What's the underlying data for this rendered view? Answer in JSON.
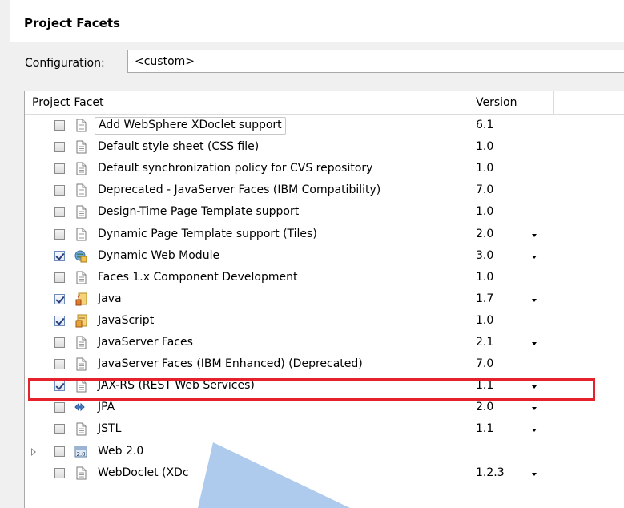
{
  "header": {
    "title": "Project Facets"
  },
  "configuration": {
    "label": "Configuration:",
    "value": "<custom>"
  },
  "table": {
    "columns": [
      "Project Facet",
      "Version"
    ],
    "rows": [
      {
        "label": "Add WebSphere XDoclet support",
        "version": "6.1",
        "checked": false,
        "icon": "document-icon",
        "dropdown": false
      },
      {
        "label": "Default style sheet (CSS file)",
        "version": "1.0",
        "checked": false,
        "icon": "document-icon",
        "dropdown": false
      },
      {
        "label": "Default synchronization policy for CVS repository",
        "version": "1.0",
        "checked": false,
        "icon": "document-icon",
        "dropdown": false
      },
      {
        "label": "Deprecated - JavaServer Faces (IBM Compatibility)",
        "version": "7.0",
        "checked": false,
        "icon": "document-icon",
        "dropdown": false
      },
      {
        "label": "Design-Time Page Template support",
        "version": "1.0",
        "checked": false,
        "icon": "document-icon",
        "dropdown": false
      },
      {
        "label": "Dynamic Page Template support (Tiles)",
        "version": "2.0",
        "checked": false,
        "icon": "document-icon",
        "dropdown": true
      },
      {
        "label": "Dynamic Web Module",
        "version": "3.0",
        "checked": true,
        "icon": "web-module-icon",
        "dropdown": true
      },
      {
        "label": "Faces 1.x Component Development",
        "version": "1.0",
        "checked": false,
        "icon": "document-icon",
        "dropdown": false
      },
      {
        "label": "Java",
        "version": "1.7",
        "checked": true,
        "icon": "java-icon",
        "dropdown": true
      },
      {
        "label": "JavaScript",
        "version": "1.0",
        "checked": true,
        "icon": "javascript-icon",
        "dropdown": false
      },
      {
        "label": "JavaServer Faces",
        "version": "2.1",
        "checked": false,
        "icon": "document-icon",
        "dropdown": true
      },
      {
        "label": "JavaServer Faces (IBM Enhanced) (Deprecated)",
        "version": "7.0",
        "checked": false,
        "icon": "document-icon",
        "dropdown": false
      },
      {
        "label": "JAX-RS (REST Web Services)",
        "version": "1.1",
        "checked": true,
        "icon": "document-icon",
        "dropdown": true
      },
      {
        "label": "JPA",
        "version": "2.0",
        "checked": false,
        "icon": "jpa-icon",
        "dropdown": true
      },
      {
        "label": "JSTL",
        "version": "1.1",
        "checked": false,
        "icon": "document-icon",
        "dropdown": true
      },
      {
        "label": "Web 2.0",
        "version": "",
        "checked": false,
        "icon": "web20-icon",
        "dropdown": false,
        "expandable": true
      },
      {
        "label": "WebDoclet (XDc",
        "version": "1.2.3",
        "checked": false,
        "icon": "document-icon",
        "dropdown": true
      }
    ]
  },
  "colors": {
    "highlight": "#e5212b",
    "pointer": "#aecbee"
  }
}
